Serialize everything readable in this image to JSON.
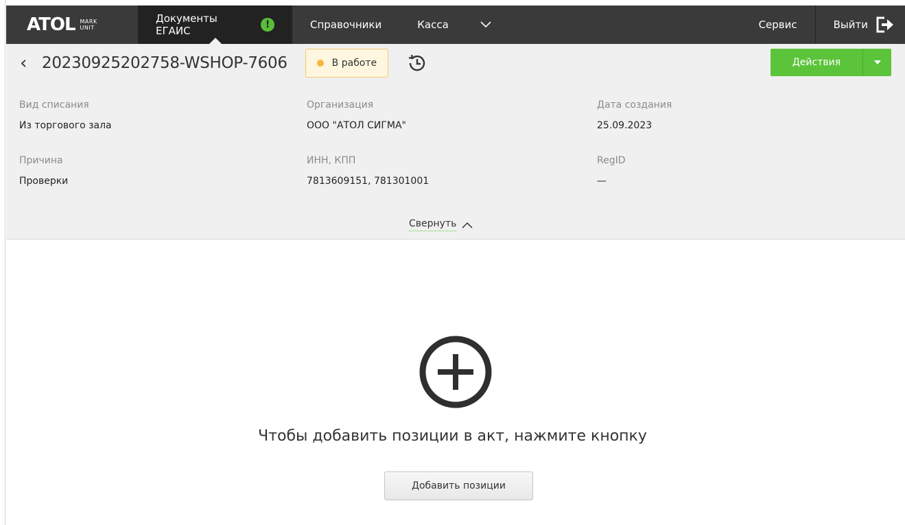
{
  "logo": {
    "name": "ATOL",
    "sub_line1": "MARK",
    "sub_line2": "UNIT"
  },
  "nav": {
    "active": {
      "label": "Документы ЕГАИС",
      "alert_badge": "!"
    },
    "items": [
      {
        "label": "Справочники"
      },
      {
        "label": "Касса"
      }
    ],
    "more_icon": "chevron-down-icon",
    "service": "Сервис",
    "logout": "Выйти"
  },
  "document": {
    "title": "20230925202758-WSHOP-7606",
    "status": "В работе",
    "actions_label": "Действия"
  },
  "fields": {
    "write_off_type": {
      "label": "Вид списания",
      "value": "Из торгового зала"
    },
    "organization": {
      "label": "Организация",
      "value": "ООО \"АТОЛ СИГМА\""
    },
    "created_date": {
      "label": "Дата создания",
      "value": "25.09.2023"
    },
    "reason": {
      "label": "Причина",
      "value": "Проверки"
    },
    "inn_kpp": {
      "label": "ИНН, КПП",
      "value": "7813609151, 781301001"
    },
    "regid": {
      "label": "RegID",
      "value": "—"
    }
  },
  "collapse_label": "Свернуть",
  "empty_state": {
    "hint": "Чтобы добавить позиции в акт, нажмите кнопку",
    "button": "Добавить позиции"
  },
  "colors": {
    "topbar": "#3a3a3a",
    "active_tab": "#222222",
    "accent_green": "#5cc43b",
    "status_bg": "#fff6df",
    "status_dot": "#f5b83d",
    "panel_bg": "#f0f0f0"
  }
}
